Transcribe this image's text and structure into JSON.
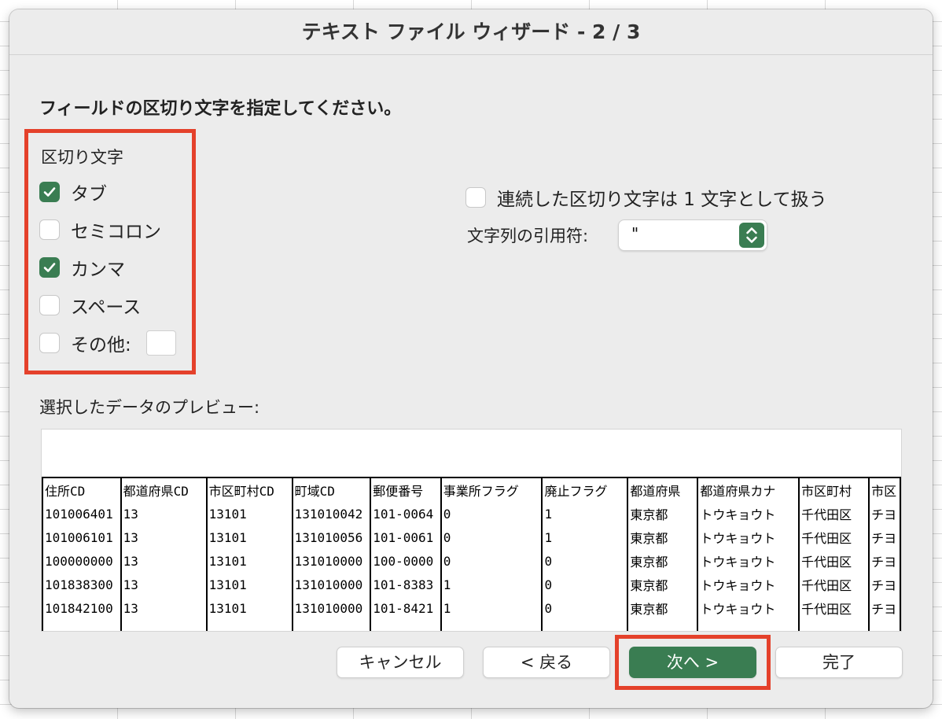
{
  "dialog": {
    "title": "テキスト ファイル ウィザード - 2 / 3",
    "instruction": "フィールドの区切り文字を指定してください。"
  },
  "delimiters": {
    "group_title": "区切り文字",
    "tab": {
      "label": "タブ",
      "checked": true
    },
    "semicolon": {
      "label": "セミコロン",
      "checked": false
    },
    "comma": {
      "label": "カンマ",
      "checked": true
    },
    "space": {
      "label": "スペース",
      "checked": false
    },
    "other": {
      "label": "その他:",
      "checked": false,
      "value": ""
    }
  },
  "options": {
    "consecutive": {
      "label": "連続した区切り文字は 1 文字として扱う",
      "checked": false
    },
    "text_qualifier_label": "文字列の引用符:",
    "text_qualifier_value": "\""
  },
  "preview": {
    "label": "選択したデータのプレビュー:",
    "columns": [
      "住所CD",
      "都道府県CD",
      "市区町村CD",
      "町域CD",
      "郵便番号",
      "事業所フラグ",
      "廃止フラグ",
      "都道府県",
      "都道府県カナ",
      "市区町村",
      "市区"
    ],
    "rows": [
      [
        "101006401",
        "13",
        "13101",
        "131010042",
        "101-0064",
        "0",
        "1",
        "東京都",
        "トウキョウト",
        "千代田区",
        "チヨ"
      ],
      [
        "101006101",
        "13",
        "13101",
        "131010056",
        "101-0061",
        "0",
        "1",
        "東京都",
        "トウキョウト",
        "千代田区",
        "チヨ"
      ],
      [
        "100000000",
        "13",
        "13101",
        "131010000",
        "100-0000",
        "0",
        "0",
        "東京都",
        "トウキョウト",
        "千代田区",
        "チヨ"
      ],
      [
        "101838300",
        "13",
        "13101",
        "131010000",
        "101-8383",
        "1",
        "0",
        "東京都",
        "トウキョウト",
        "千代田区",
        "チヨ"
      ],
      [
        "101842100",
        "13",
        "13101",
        "131010000",
        "101-8421",
        "1",
        "0",
        "東京都",
        "トウキョウト",
        "千代田区",
        "チヨ"
      ]
    ]
  },
  "buttons": {
    "cancel": "キャンセル",
    "back": "< 戻る",
    "next": "次へ >",
    "finish": "完了"
  },
  "colors": {
    "accent": "#3a7d52",
    "highlight": "#e4412b"
  }
}
